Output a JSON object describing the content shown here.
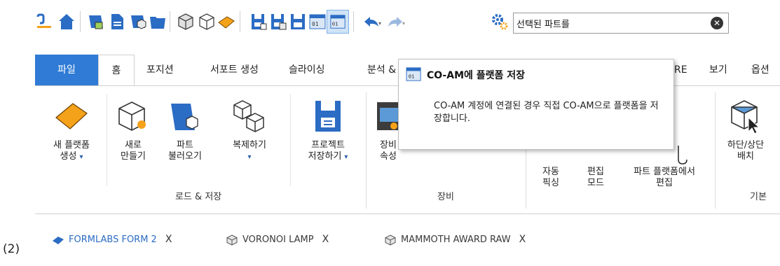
{
  "quick_access": {
    "icons": [
      "align-icon",
      "home-icon",
      "load-platform-icon",
      "new-doc-icon",
      "load-part-icon",
      "open-folder-icon",
      "part-gray-icon",
      "part-white-icon",
      "platform-orange-icon",
      "save-project-icon",
      "save-as-project-icon",
      "save-icon",
      "export-icon",
      "save-to-coam-icon",
      "undo-icon",
      "redo-icon",
      "settings-icon"
    ],
    "search": {
      "value": "선택된 파트를",
      "clear": "✕"
    }
  },
  "ribbon_tabs": [
    "파일",
    "홈",
    "포지션",
    "서포트 생성",
    "슬라이싱",
    "분석 &",
    "RE",
    "보기",
    "옵션"
  ],
  "groups": {
    "load_save": {
      "label": "로드 & 저장",
      "buttons": [
        {
          "line1": "새 플랫폼",
          "line2": "생성"
        },
        {
          "line1": "새로",
          "line2": "만들기"
        },
        {
          "line1": "파트",
          "line2": "불러오기"
        },
        {
          "line1": "복제하기",
          "line2": ""
        },
        {
          "line1": "프로젝트",
          "line2": "저장하기"
        }
      ]
    },
    "equipment": {
      "label": "장비",
      "buttons": [
        {
          "line1": "장비",
          "line2": "속성"
        }
      ]
    },
    "edit": {
      "buttons": [
        {
          "line1": "자동",
          "line2": "픽싱"
        },
        {
          "line1": "편집",
          "line2": "모드"
        },
        {
          "line1": "파트 플랫폼에서",
          "line2": "편집"
        }
      ]
    },
    "basic": {
      "label": "기본",
      "buttons": [
        {
          "line1": "하단/상단",
          "line2": "배치"
        }
      ]
    }
  },
  "tooltip": {
    "title": "CO-AM에 플랫폼 저장",
    "body": "CO-AM 계정에 연결된 경우 직접 CO-AM으로 플랫폼을 저장합니다."
  },
  "doc_tabs": {
    "figure_label": "(2)",
    "tabs": [
      {
        "name": "FORMLABS FORM 2",
        "close": "X"
      },
      {
        "name": "VORONOI LAMP",
        "close": "X"
      },
      {
        "name": "MAMMOTH AWARD RAW",
        "close": "X"
      }
    ]
  },
  "colors": {
    "file_tab": "#2f7bd6",
    "accent_blue": "#2b6cc4",
    "orange": "#f5a21b"
  }
}
